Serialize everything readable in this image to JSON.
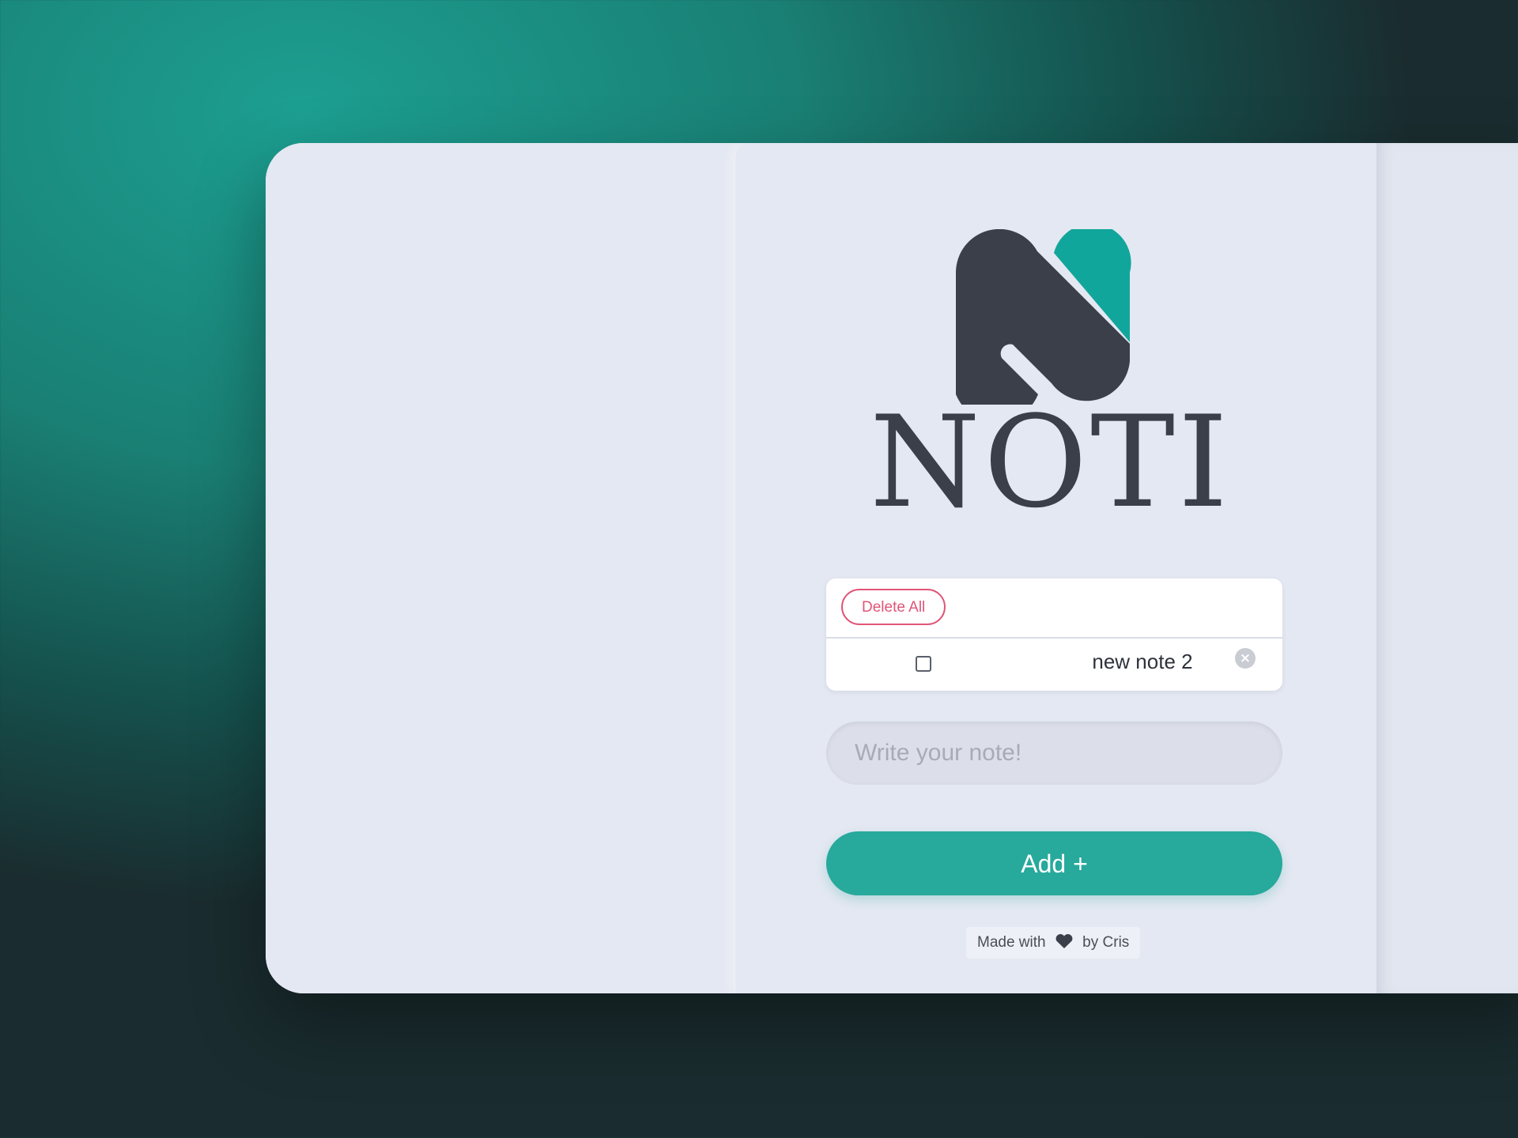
{
  "brand": {
    "wordmark": "NOTI",
    "logo_icon": "noti-n-logo-icon",
    "colors": {
      "dark": "#3a3f4a",
      "accent": "#11a69b"
    }
  },
  "notes_panel": {
    "delete_all_label": "Delete All",
    "notes": [
      {
        "text": "new note 2",
        "checked": false
      }
    ]
  },
  "input": {
    "placeholder": "Write your note!",
    "value": ""
  },
  "add_button": {
    "label": "Add +",
    "color": "#27a99c"
  },
  "footer": {
    "prefix": "Made with",
    "icon": "heart-icon",
    "suffix": "by Cris"
  },
  "colors": {
    "delete_accent": "#e05577",
    "panel_bg": "#e4e8f2"
  }
}
